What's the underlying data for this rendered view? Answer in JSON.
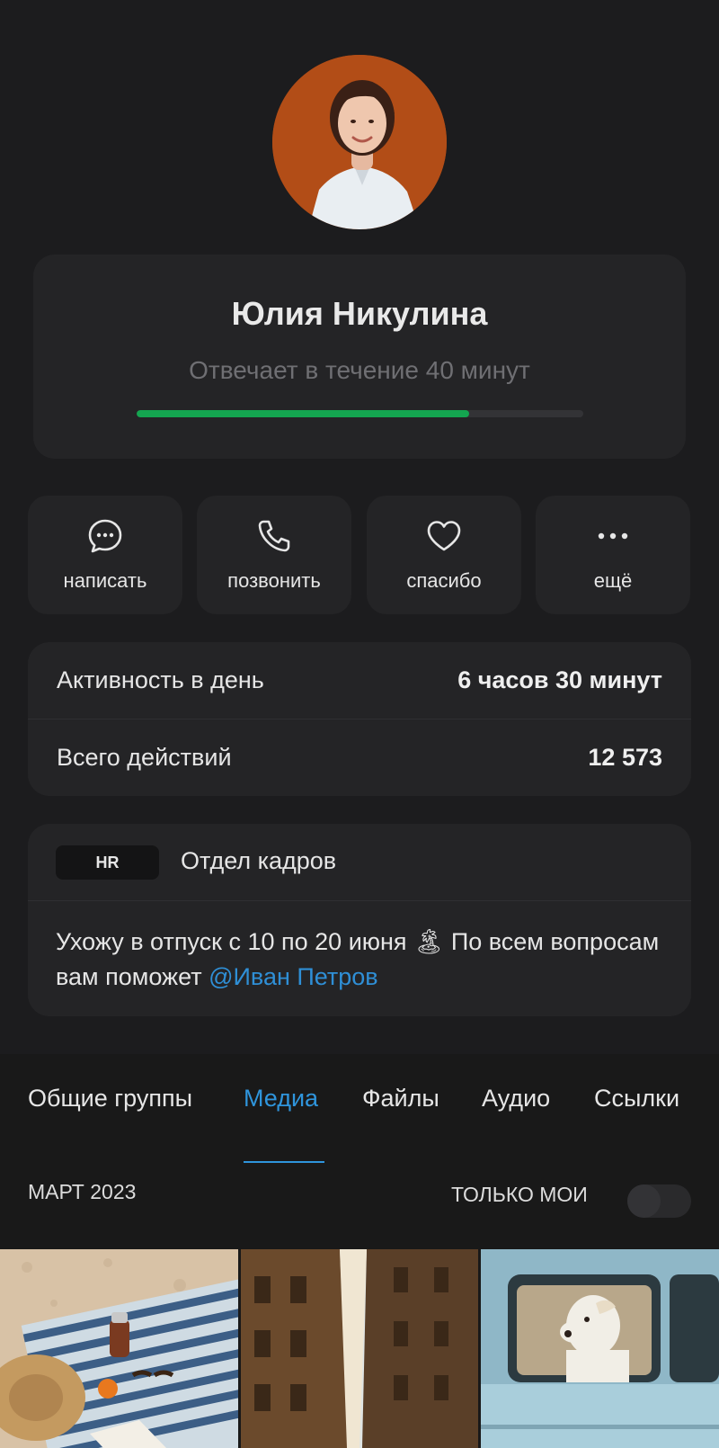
{
  "profile": {
    "name": "Юлия Никулина",
    "status": "Отвечает в течение 40 минут",
    "response_progress": 0.745
  },
  "actions": [
    {
      "label": "написать",
      "icon": "chat-bubble-icon"
    },
    {
      "label": "позвонить",
      "icon": "phone-icon"
    },
    {
      "label": "спасибо",
      "icon": "heart-icon"
    },
    {
      "label": "ещё",
      "icon": "more-dots-icon"
    }
  ],
  "stats": [
    {
      "label": "Активность в день",
      "value": "6 часов 30 минут"
    },
    {
      "label": "Всего действий",
      "value": "12 573"
    }
  ],
  "department": {
    "badge": "HR",
    "name": "Отдел кадров"
  },
  "status_message": {
    "text": "Ухожу в отпуск с 10 по 20 июня 🏝 По всем вопросам вам поможет ",
    "mention": "@Иван Петров"
  },
  "tabs": [
    {
      "label": "Общие группы",
      "active": false
    },
    {
      "label": "Медиа",
      "active": true
    },
    {
      "label": "Файлы",
      "active": false
    },
    {
      "label": "Аудио",
      "active": false
    },
    {
      "label": "Ссылки",
      "active": false
    }
  ],
  "media": {
    "month": "МАРТ 2023",
    "only_mine_label": "ТОЛЬКО МОИ",
    "only_mine_on": false
  },
  "colors": {
    "accent_blue": "#2f95dc",
    "progress_green": "#14a550",
    "background": "#1c1c1e",
    "card": "#242426"
  }
}
